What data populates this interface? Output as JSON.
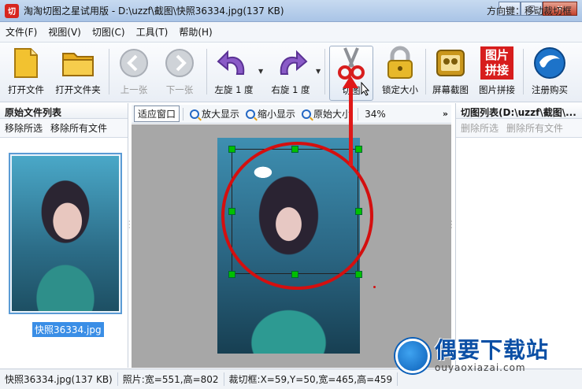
{
  "window": {
    "title": "淘淘切图之星试用版 - D:\\uzzf\\截图\\快照36334.jpg(137 KB)",
    "icon_text": "切",
    "minimize": "—",
    "maximize": "□",
    "close": "✕"
  },
  "menu": [
    "文件(F)",
    "视图(V)",
    "切图(C)",
    "工具(T)",
    "帮助(H)"
  ],
  "toolbar": {
    "open_file": "打开文件",
    "open_folder": "打开文件夹",
    "prev": "上一张",
    "next": "下一张",
    "rotate_left": "左旋 1 度",
    "rotate_right": "右旋 1 度",
    "cut": "切图",
    "lock_size": "锁定大小",
    "screen_capture": "屏幕截图",
    "image_splice": "图片拼接",
    "register": "注册购买",
    "splice_icon_text": "图片拼接"
  },
  "left_panel": {
    "title": "原始文件列表",
    "remove_selected": "移除所选",
    "remove_all": "移除所有文件",
    "thumb_caption": "快照36334.jpg"
  },
  "view_tools": {
    "fit_window": "适应窗口",
    "zoom_in": "放大显示",
    "zoom_out": "缩小显示",
    "original": "原始大小",
    "zoom_level": "34%",
    "more": "»"
  },
  "right_panel": {
    "title": "切图列表(D:\\uzzf\\截图\\...",
    "delete_selected": "删除所选",
    "delete_all": "删除所有文件"
  },
  "status": {
    "file": "快照36334.jpg(137 KB)",
    "photo_size": "照片:宽=551,高=802",
    "crop_box": "裁切框:X=59,Y=50,宽=465,高=459",
    "hint": "方向键：移动裁切框"
  },
  "watermark": {
    "name": "偶要下载站",
    "url": "ouyaoxiazai.com"
  },
  "colors": {
    "highlight_red": "#d40f0f",
    "handle_green": "#00c000",
    "selection_blue": "#3a8ee6"
  }
}
